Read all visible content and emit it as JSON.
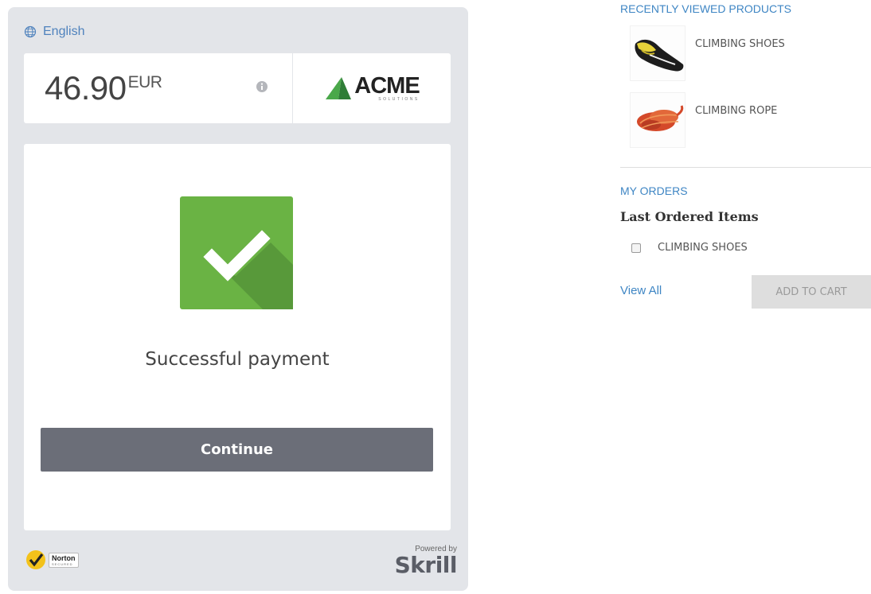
{
  "payment": {
    "language": "English",
    "amount": "46.90",
    "currency": "EUR",
    "merchant": {
      "name": "ACME",
      "tagline": "SOLUTIONS"
    },
    "status_text": "Successful payment",
    "continue_label": "Continue",
    "norton": {
      "name": "Norton",
      "tagline": "SECURED"
    },
    "powered_by": "Powered by",
    "provider": "Skrill",
    "colors": {
      "widget_bg": "#e3e5e9",
      "success_green": "#6ab344",
      "button_gray": "#6b6e78",
      "link_blue": "#4f82bd"
    }
  },
  "sidebar": {
    "recently_viewed_title": "RECENTLY VIEWED PRODUCTS",
    "products": [
      {
        "name": "CLIMBING SHOES",
        "icon": "climbing-shoe-icon"
      },
      {
        "name": "CLIMBING ROPE",
        "icon": "climbing-rope-icon"
      }
    ],
    "my_orders_title": "MY ORDERS",
    "last_ordered_title": "Last Ordered Items",
    "ordered_items": [
      {
        "name": "CLIMBING SHOES",
        "checked": false
      }
    ],
    "view_all_label": "View All",
    "add_to_cart_label": "ADD TO CART",
    "colors": {
      "link_blue": "#3f86c4"
    }
  }
}
